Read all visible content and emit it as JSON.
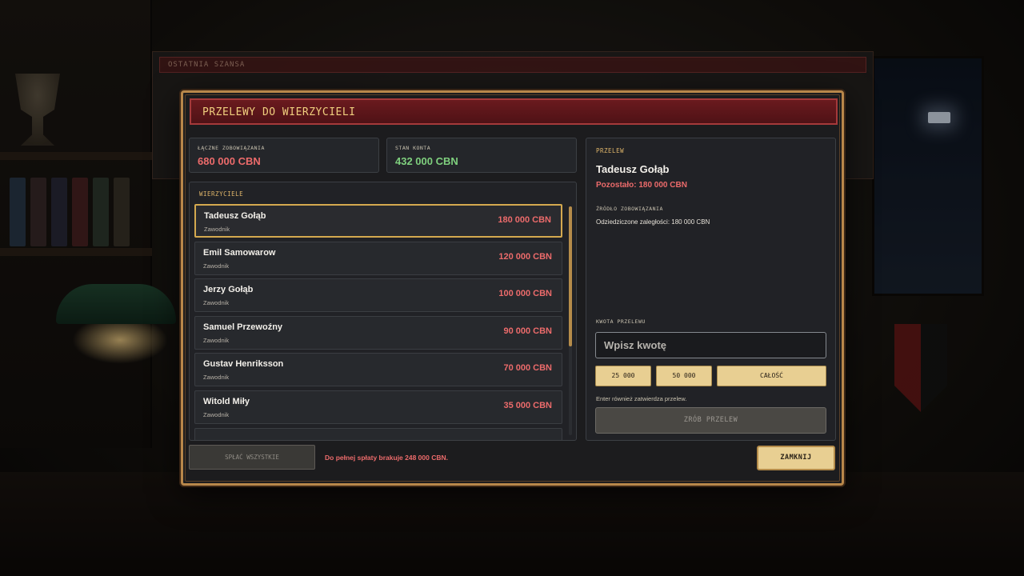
{
  "background": {
    "panel_title": "OSTATNIA SZANSA"
  },
  "modal": {
    "title": "PRZELEWY DO WIERZYCIELI",
    "stats": {
      "total_label": "ŁĄCZNE ZOBOWIĄZANIA",
      "total_value": "680 000 CBN",
      "balance_label": "STAN KONTA",
      "balance_value": "432 000 CBN"
    },
    "creditors": {
      "label": "WIERZYCIELE",
      "scroll_position": 0.0,
      "items": [
        {
          "name": "Tadeusz Gołąb",
          "role": "Zawodnik",
          "amount": "180 000 CBN",
          "selected": true
        },
        {
          "name": "Emil Samowarow",
          "role": "Zawodnik",
          "amount": "120 000 CBN",
          "selected": false
        },
        {
          "name": "Jerzy Gołąb",
          "role": "Zawodnik",
          "amount": "100 000 CBN",
          "selected": false
        },
        {
          "name": "Samuel Przewoźny",
          "role": "Zawodnik",
          "amount": "90 000 CBN",
          "selected": false
        },
        {
          "name": "Gustav Henriksson",
          "role": "Zawodnik",
          "amount": "70 000 CBN",
          "selected": false
        },
        {
          "name": "Witold Miły",
          "role": "Zawodnik",
          "amount": "35 000 CBN",
          "selected": false
        }
      ]
    },
    "transfer": {
      "label": "PRZELEW",
      "recipient": "Tadeusz Gołąb",
      "remaining": "Pozostało: 180 000 CBN",
      "source_label": "ŹRÓDŁO ZOBOWIĄZANIA",
      "source_value": "Odziedziczone zaległości: 180 000 CBN",
      "amount_label": "KWOTA PRZELEWU",
      "amount_placeholder": "Wpisz kwotę",
      "amount_value": "",
      "quick_amounts": [
        "25 000",
        "50 000",
        "CAŁOŚĆ"
      ],
      "hint": "Enter również zatwierdza przelew.",
      "submit_label": "ZRÓB PRZELEW"
    },
    "footer": {
      "pay_all_label": "SPŁAĆ WSZYSTKIE",
      "missing_note": "Do pełnej spłaty brakuje 248 000 CBN.",
      "close_label": "ZAMKNIJ"
    }
  }
}
